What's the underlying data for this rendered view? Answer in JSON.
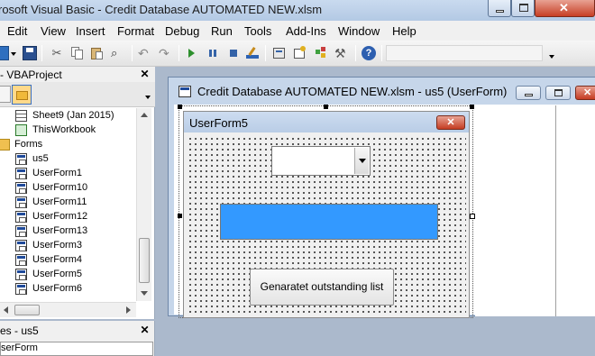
{
  "window": {
    "title": "rosoft Visual Basic - Credit Database AUTOMATED NEW.xlsm"
  },
  "menu": [
    "Edit",
    "View",
    "Insert",
    "Format",
    "Debug",
    "Run",
    "Tools",
    "Add-Ins",
    "Window",
    "Help"
  ],
  "project_panel": {
    "title": "- VBAProject",
    "close": "✕",
    "tree": [
      {
        "label": "Sheet9 (Jan 2015)",
        "icon": "sheet-icon"
      },
      {
        "label": "ThisWorkbook",
        "icon": "workbook-icon"
      },
      {
        "label": "Forms",
        "icon": "folder-icon"
      },
      {
        "label": "us5",
        "icon": "form-icon"
      },
      {
        "label": "UserForm1",
        "icon": "form-icon"
      },
      {
        "label": "UserForm10",
        "icon": "form-icon"
      },
      {
        "label": "UserForm11",
        "icon": "form-icon"
      },
      {
        "label": "UserForm12",
        "icon": "form-icon"
      },
      {
        "label": "UserForm13",
        "icon": "form-icon"
      },
      {
        "label": "UserForm3",
        "icon": "form-icon"
      },
      {
        "label": "UserForm4",
        "icon": "form-icon"
      },
      {
        "label": "UserForm5",
        "icon": "form-icon"
      },
      {
        "label": "UserForm6",
        "icon": "form-icon"
      }
    ]
  },
  "properties_panel": {
    "title": "es - us5",
    "close": "✕",
    "object": "serForm"
  },
  "designer": {
    "title": "Credit Database AUTOMATED NEW.xlsm - us5 (UserForm)"
  },
  "userform": {
    "caption": "UserForm5",
    "close": "✕",
    "button_label": "Genaratet outstanding list"
  },
  "colors": {
    "accent_bar": "#3399ff",
    "title_gradient": "#c6d6ea"
  }
}
